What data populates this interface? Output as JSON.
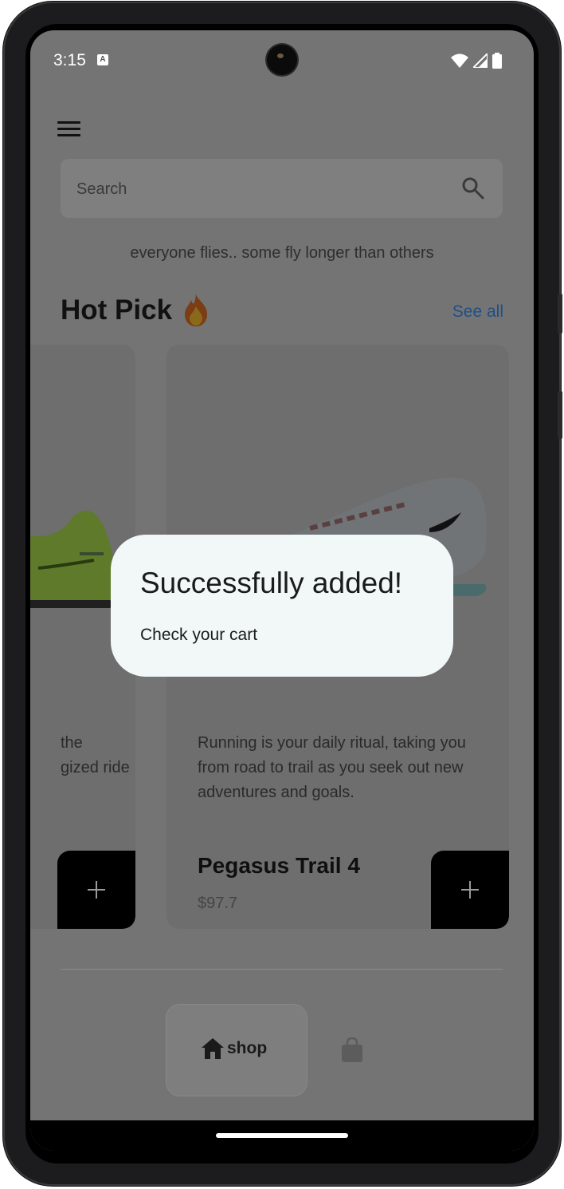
{
  "status_bar": {
    "time": "3:15",
    "notification_icon": "A"
  },
  "search": {
    "placeholder": "Search"
  },
  "tagline": "everyone flies.. some fly longer than others",
  "section": {
    "title": "Hot Pick",
    "see_all": "See all"
  },
  "products": [
    {
      "description_partial": "the\ngized ride"
    },
    {
      "description": "Running is your daily ritual, taking you from road to trail as you seek out new adventures and goals.",
      "name": "Pegasus Trail 4",
      "price": "$97.7"
    }
  ],
  "nav": {
    "shop_label": "shop"
  },
  "dialog": {
    "title": "Successfully added!",
    "message": "Check your cart"
  },
  "colors": {
    "overlay_background": "#747474",
    "dialog_background": "#f2f8f8",
    "add_button": "#000000",
    "see_all_link": "#1f4f86"
  }
}
